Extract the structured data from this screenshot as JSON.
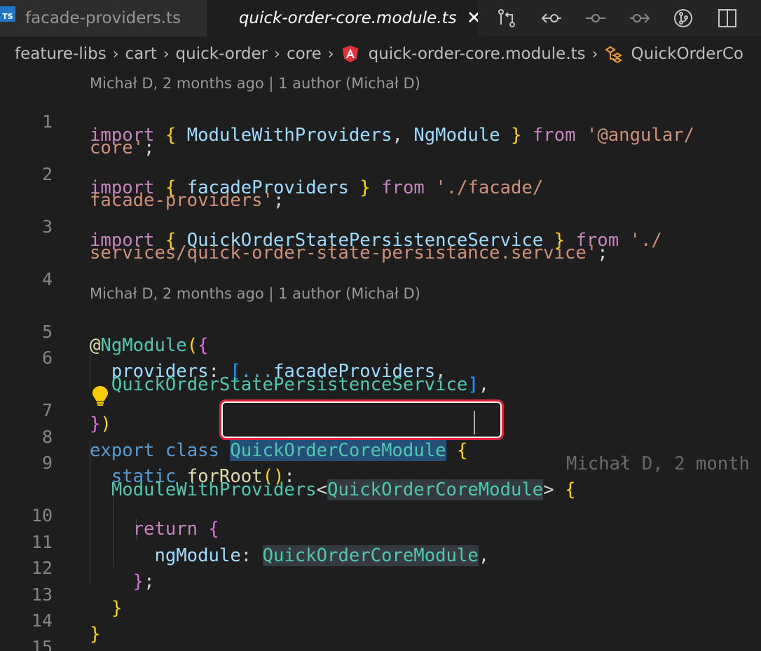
{
  "tabs": [
    {
      "label": "facade-providers.ts",
      "icon": "ts-file-icon",
      "icon_text": "TS",
      "active": false
    },
    {
      "label": "quick-order-core.module.ts",
      "icon": "angular-icon",
      "active": true,
      "close": "✕"
    }
  ],
  "toolbar_icons": [
    "open-changes-icon",
    "previous-change-icon",
    "git-commit-icon",
    "next-change-icon",
    "git-lens-icon",
    "split-editor-icon"
  ],
  "breadcrumb": [
    "feature-libs",
    "cart",
    "quick-order",
    "core",
    "quick-order-core.module.ts",
    "QuickOrderCo"
  ],
  "breadcrumb_separator": "›",
  "codelens": {
    "first": "Michał D, 2 months ago | 1 author (Michał D)",
    "second": "Michał D, 2 months ago | 1 author (Michał D)"
  },
  "line_numbers": [
    "1",
    "2",
    "3",
    "4",
    "5",
    "6",
    "7",
    "8",
    "9",
    "10",
    "11",
    "12",
    "13",
    "14",
    "15"
  ],
  "code": {
    "l1a": {
      "kw": "import",
      "o": "{",
      "a": "ModuleWithProviders",
      "comma": ",",
      "b": "NgModule",
      "c": "}",
      "from": "from",
      "str": "'@angular/"
    },
    "l1b": {
      "str": "core'",
      "semi": ";"
    },
    "l2a": {
      "kw": "import",
      "o": "{",
      "a": "facadeProviders",
      "c": "}",
      "from": "from",
      "str": "'./facade/"
    },
    "l2b": {
      "str": "facade-providers'",
      "semi": ";"
    },
    "l3a": {
      "kw": "import",
      "o": "{",
      "a": "QuickOrderStatePersistenceService",
      "c": "}",
      "from": "from",
      "str": "'./"
    },
    "l3b": {
      "str": "services/quick-order-state-persistance.service'",
      "semi": ";"
    },
    "l5": {
      "at": "@",
      "dec": "NgModule",
      "p": "(",
      "o": "{"
    },
    "l6a": {
      "prop": "providers",
      "colon": ":",
      "ob": "[",
      "spread": "...",
      "id": "facadeProviders",
      "comma": ","
    },
    "l6b": {
      "id": "QuickOrderStatePersistenceService",
      "cb": "]",
      "comma": ","
    },
    "l7": {
      "c": "}",
      "p": ")"
    },
    "l8": {
      "kw1": "export",
      "kw2": "class",
      "name": "QuickOrderCoreModule",
      "o": "{",
      "blame": "Michał D, 2 month"
    },
    "l9a": {
      "kw": "static",
      "fn": "forRoot",
      "p": "()",
      "colon": ":"
    },
    "l9b": {
      "ty": "ModuleWithProviders",
      "lt": "<",
      "name": "QuickOrderCoreModule",
      "gt": ">",
      "o": "{"
    },
    "l10": {
      "kw": "return",
      "o": "{"
    },
    "l11": {
      "prop": "ngModule",
      "colon": ":",
      "name": "QuickOrderCoreModule",
      "comma": ","
    },
    "l12": {
      "c": "}",
      "semi": ";"
    },
    "l13": {
      "c": "}"
    },
    "l14": {
      "c": "}"
    }
  },
  "colors": {
    "background": "#1e1e1e",
    "highlight": "#264f78",
    "annotation": "#e0263a"
  }
}
